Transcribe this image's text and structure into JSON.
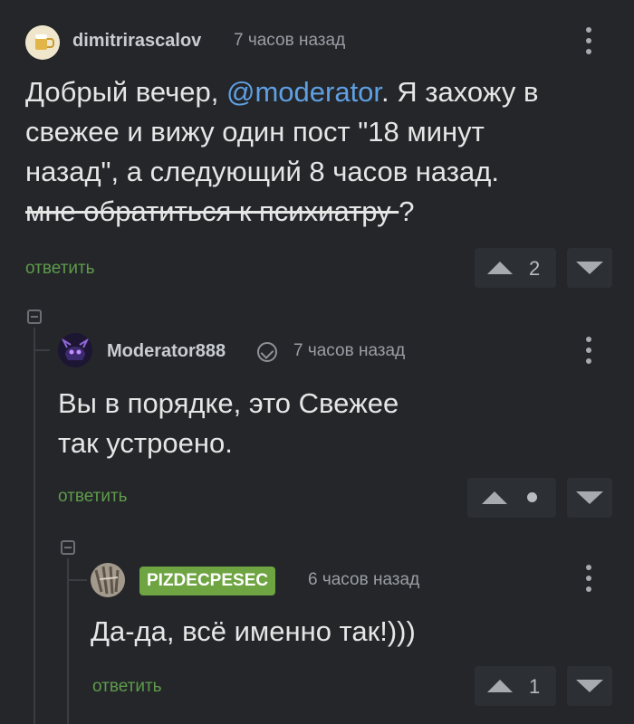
{
  "comments": [
    {
      "username": "dimitrirascalov",
      "timestamp": "7 часов назад",
      "text": {
        "line1_a": "Добрый вечер, ",
        "line1_mention": "@moderator",
        "line1_b": ". Я захожу в",
        "line2": "свежее и вижу один пост \"18 минут",
        "line3": "назад\",  а следующий 8 часов назад.",
        "line4_strike": "мне обратиться к психиатру ",
        "line4_tail": "?"
      },
      "reply_label": "ответить",
      "vote_count": "2",
      "avatar_icon": "beer-mug-avatar-icon"
    },
    {
      "username": "Moderator888",
      "timestamp": "7 часов назад",
      "text": {
        "line1": "Вы в порядке, это Свежее",
        "line2": "так устроено."
      },
      "reply_label": "ответить",
      "vote_indicator": "dot",
      "avatar_icon": "moderator-mask-avatar-icon",
      "badge_icon": "moderator-verified-icon"
    },
    {
      "username": "PIZDECPESEC",
      "timestamp": "6 часов назад",
      "text": {
        "line1": "Да-да, всё именно так!)))"
      },
      "reply_label": "ответить",
      "vote_count": "1",
      "avatar_icon": "photo-avatar-icon",
      "badge_color": "#6ea441"
    }
  ],
  "colors": {
    "background": "#24262a",
    "mention": "#5fa0e3",
    "reply_link": "#5f9b4b",
    "badge": "#6ea441"
  }
}
